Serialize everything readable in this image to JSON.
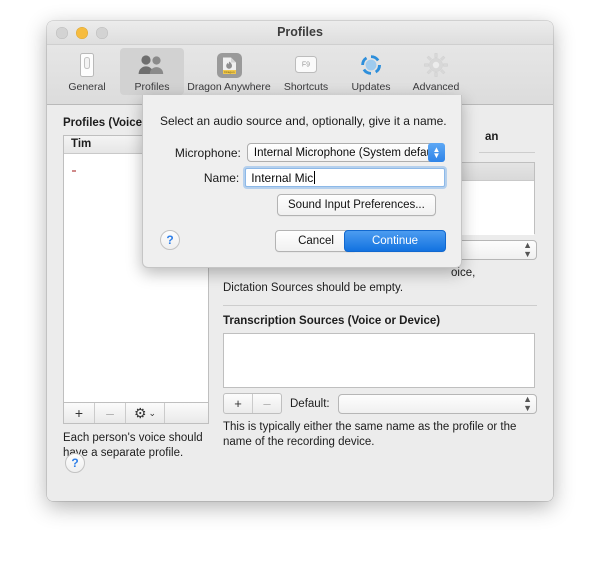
{
  "window": {
    "title": "Profiles",
    "traffic_lights": [
      "close",
      "minimize",
      "zoom"
    ]
  },
  "toolbar": {
    "items": [
      {
        "label": "General",
        "icon": "general-icon"
      },
      {
        "label": "Profiles",
        "icon": "profiles-icon",
        "selected": true
      },
      {
        "label": "Dragon Anywhere",
        "icon": "dragon-anywhere-icon"
      },
      {
        "label": "Shortcuts",
        "icon": "shortcuts-f9-icon"
      },
      {
        "label": "Updates",
        "icon": "updates-refresh-icon"
      },
      {
        "label": "Advanced",
        "icon": "advanced-gear-icon"
      }
    ]
  },
  "left_panel": {
    "title": "Profiles (Voices",
    "list_header": "Tim",
    "buttons": {
      "add": "+",
      "remove": "–",
      "gear": "⚙",
      "gear_chevron": "⌄"
    },
    "note": "Each person's voice should have a separate profile."
  },
  "right_panel": {
    "partial_heading": "an",
    "dictation_note_line1": "oice,",
    "dictation_note_line2": "Dictation Sources should be empty.",
    "transcription_title": "Transcription Sources (Voice or Device)",
    "buttons": {
      "add": "+",
      "remove": "–"
    },
    "default_label": "Default:",
    "default_value": "",
    "footer_note": "This is typically either the same name as the profile or the name of the recording device.",
    "status_dot_color": "#3ecb46"
  },
  "help_button": {
    "glyph": "?"
  },
  "sheet": {
    "message": "Select an audio source and, optionally, give it a name.",
    "microphone_label": "Microphone:",
    "microphone_value": "Internal Microphone (System default)",
    "name_label": "Name:",
    "name_value": "Internal Mic",
    "name_placeholder": "",
    "sound_prefs_button": "Sound Input Preferences...",
    "cancel_button": "Cancel",
    "continue_button": "Continue",
    "help_glyph": "?",
    "accent_color": "#1272e0"
  }
}
